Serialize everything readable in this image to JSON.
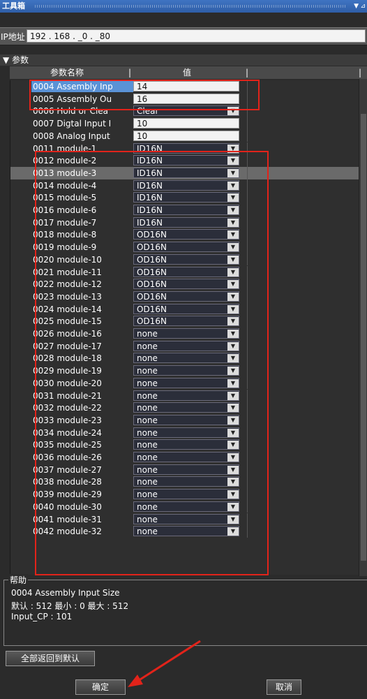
{
  "title": {
    "text": "工具箱"
  },
  "ip": {
    "label": "IP地址",
    "value": "192 . 168 . _0 . _80"
  },
  "params": {
    "section_label": "▼ 参数",
    "col_name": "参数名称",
    "col_value": "值",
    "rows": [
      {
        "name": "0004 Assembly Inp",
        "value": "14",
        "kind": "edit"
      },
      {
        "name": "0005 Assembly Ou",
        "value": "16",
        "kind": "edit"
      },
      {
        "name": "0006 Hold or Clea",
        "value": "Clear",
        "kind": "dropdown"
      },
      {
        "name": "0007 Digtal Input I",
        "value": "10",
        "kind": "edit"
      },
      {
        "name": "0008 Analog Input",
        "value": "10",
        "kind": "edit"
      },
      {
        "name": "0011 module-1",
        "value": "ID16N",
        "kind": "dropdown"
      },
      {
        "name": "0012 module-2",
        "value": "ID16N",
        "kind": "dropdown"
      },
      {
        "name": "0013 module-3",
        "value": "ID16N",
        "kind": "dropdown"
      },
      {
        "name": "0014 module-4",
        "value": "ID16N",
        "kind": "dropdown"
      },
      {
        "name": "0015 module-5",
        "value": "ID16N",
        "kind": "dropdown"
      },
      {
        "name": "0016 module-6",
        "value": "ID16N",
        "kind": "dropdown"
      },
      {
        "name": "0017 module-7",
        "value": "ID16N",
        "kind": "dropdown"
      },
      {
        "name": "0018 module-8",
        "value": "OD16N",
        "kind": "dropdown"
      },
      {
        "name": "0019 module-9",
        "value": "OD16N",
        "kind": "dropdown"
      },
      {
        "name": "0020 module-10",
        "value": "OD16N",
        "kind": "dropdown"
      },
      {
        "name": "0021 module-11",
        "value": "OD16N",
        "kind": "dropdown"
      },
      {
        "name": "0022 module-12",
        "value": "OD16N",
        "kind": "dropdown"
      },
      {
        "name": "0023 module-13",
        "value": "OD16N",
        "kind": "dropdown"
      },
      {
        "name": "0024 module-14",
        "value": "OD16N",
        "kind": "dropdown"
      },
      {
        "name": "0025 module-15",
        "value": "OD16N",
        "kind": "dropdown"
      },
      {
        "name": "0026 module-16",
        "value": "none",
        "kind": "dropdown"
      },
      {
        "name": "0027 module-17",
        "value": "none",
        "kind": "dropdown"
      },
      {
        "name": "0028 module-18",
        "value": "none",
        "kind": "dropdown"
      },
      {
        "name": "0029 module-19",
        "value": "none",
        "kind": "dropdown"
      },
      {
        "name": "0030 module-20",
        "value": "none",
        "kind": "dropdown"
      },
      {
        "name": "0031 module-21",
        "value": "none",
        "kind": "dropdown"
      },
      {
        "name": "0032 module-22",
        "value": "none",
        "kind": "dropdown"
      },
      {
        "name": "0033 module-23",
        "value": "none",
        "kind": "dropdown"
      },
      {
        "name": "0034 module-24",
        "value": "none",
        "kind": "dropdown"
      },
      {
        "name": "0035 module-25",
        "value": "none",
        "kind": "dropdown"
      },
      {
        "name": "0036 module-26",
        "value": "none",
        "kind": "dropdown"
      },
      {
        "name": "0037 module-27",
        "value": "none",
        "kind": "dropdown"
      },
      {
        "name": "0038 module-28",
        "value": "none",
        "kind": "dropdown"
      },
      {
        "name": "0039 module-29",
        "value": "none",
        "kind": "dropdown"
      },
      {
        "name": "0040 module-30",
        "value": "none",
        "kind": "dropdown"
      },
      {
        "name": "0041 module-31",
        "value": "none",
        "kind": "dropdown"
      },
      {
        "name": "0042 module-32",
        "value": "none",
        "kind": "dropdown"
      }
    ]
  },
  "help": {
    "title": "帮助",
    "line1": "0004 Assembly Input Size",
    "line2": "默认 : 512  最小 : 0  最大 : 512",
    "line3": "Input_CP : 101"
  },
  "buttons": {
    "reset_label": "全部返回到默认",
    "ok_label": "确定",
    "cancel_label": "取消"
  },
  "colors": {
    "highlight": "#e2231a",
    "selection": "#5a92d6"
  }
}
